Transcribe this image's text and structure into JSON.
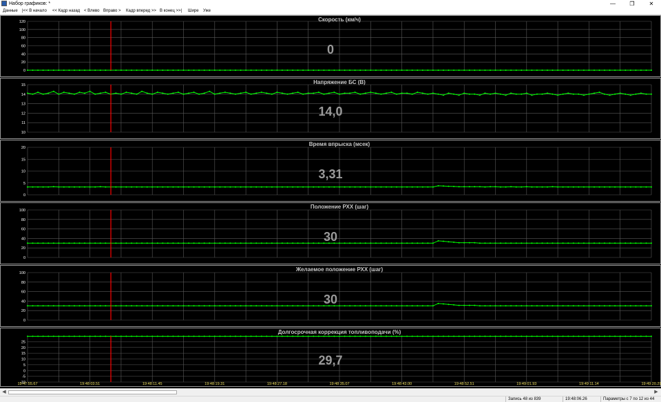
{
  "window": {
    "title": "Набор графиков: *",
    "buttons": [
      "—",
      "❐",
      "✕"
    ]
  },
  "menu": [
    "Данные",
    "|<< В начало",
    "<< Кадр назад",
    "< Влево",
    "Вправо >",
    "Кадр вперед >>",
    "В конец >>|",
    "Шире",
    "Уже"
  ],
  "status": {
    "record": "Запись 48 из 839",
    "time": "19:48:06.26",
    "params": "Параметры с 7 по 12 из 44"
  },
  "colors": {
    "background": "#000000",
    "grid": "#5a5a5a",
    "series": "#00ff00",
    "cursor": "#ff0000",
    "title": "#c8c8c8",
    "value": "#9a9a9a",
    "xtick": "#f0e060"
  },
  "chart_data": [
    {
      "type": "line",
      "title": "Скорость  (км/ч)",
      "ylim": [
        0,
        120
      ],
      "yticks": [
        "120",
        "100",
        "80",
        "60",
        "40",
        "20",
        "0"
      ],
      "current_value": "0",
      "values": [
        0,
        0,
        0,
        0,
        0,
        0,
        0,
        0,
        0,
        0,
        0,
        0,
        0,
        0,
        0,
        0,
        0,
        0,
        0,
        0,
        0,
        0,
        0,
        0,
        0,
        0,
        0,
        0,
        0,
        0,
        0,
        0,
        0,
        0,
        0,
        0,
        0,
        0,
        0,
        0,
        0,
        0,
        0,
        0,
        0,
        0,
        0,
        0,
        0,
        0,
        0,
        0,
        0,
        0,
        0,
        0,
        0,
        0,
        0,
        0,
        0,
        0,
        0,
        0,
        0,
        0,
        0,
        0,
        0,
        0,
        0,
        0,
        0,
        0,
        0,
        0,
        0,
        0,
        0,
        0,
        0,
        0,
        0,
        0,
        0,
        0,
        0,
        0,
        0,
        0,
        0,
        0,
        0,
        0,
        0,
        0,
        0,
        0,
        0,
        0,
        0,
        0,
        0,
        0,
        0,
        0,
        0,
        0,
        0,
        0,
        0,
        0,
        0,
        0,
        0,
        0,
        0,
        0,
        0,
        0,
        0
      ]
    },
    {
      "type": "line",
      "title": "Напряжение БС  (В)",
      "ylim": [
        10,
        15
      ],
      "yticks": [
        "15",
        "14",
        "13",
        "12",
        "11",
        "10"
      ],
      "current_value": "14,0",
      "values": [
        14.1,
        14.0,
        14.2,
        14.0,
        14.1,
        14.3,
        14.0,
        14.2,
        14.1,
        14.0,
        14.2,
        14.1,
        14.3,
        14.0,
        14.1,
        14.2,
        14.0,
        14.1,
        14.0,
        14.2,
        14.1,
        14.0,
        14.3,
        14.1,
        14.0,
        14.2,
        14.1,
        14.0,
        14.1,
        14.2,
        14.0,
        14.1,
        14.2,
        14.0,
        14.1,
        14.3,
        14.0,
        14.1,
        14.2,
        14.1,
        14.0,
        14.1,
        14.2,
        14.0,
        14.1,
        14.2,
        14.1,
        14.0,
        14.2,
        14.1,
        14.0,
        14.1,
        14.2,
        14.0,
        14.1,
        14.1,
        14.2,
        14.0,
        14.1,
        14.2,
        14.0,
        14.1,
        14.1,
        14.2,
        14.0,
        14.1,
        14.2,
        14.1,
        14.0,
        14.1,
        14.2,
        14.0,
        14.1,
        14.1,
        14.0,
        14.2,
        14.1,
        14.0,
        14.1,
        14.0,
        13.9,
        14.1,
        14.0,
        13.9,
        14.1,
        14.0,
        14.0,
        13.9,
        14.1,
        14.0,
        14.1,
        14.0,
        13.9,
        14.1,
        14.0,
        14.0,
        14.1,
        13.9,
        14.0,
        14.0,
        14.1,
        14.0,
        13.9,
        14.0,
        14.1,
        14.0,
        14.0,
        13.9,
        14.0,
        14.1,
        14.2,
        14.0,
        13.9,
        14.0,
        14.1,
        14.0,
        13.9,
        14.0,
        14.1,
        14.0,
        14.0
      ]
    },
    {
      "type": "line",
      "title": "Время впрыска  (мсек)",
      "ylim": [
        0,
        20
      ],
      "yticks": [
        "20",
        "15",
        "10",
        "5",
        "0"
      ],
      "current_value": "3,31",
      "values": [
        3.3,
        3.3,
        3.3,
        3.3,
        3.3,
        3.4,
        3.3,
        3.3,
        3.3,
        3.3,
        3.3,
        3.3,
        3.3,
        3.3,
        3.4,
        3.3,
        3.3,
        3.3,
        3.3,
        3.3,
        3.3,
        3.3,
        3.3,
        3.3,
        3.3,
        3.3,
        3.3,
        3.3,
        3.3,
        3.3,
        3.3,
        3.3,
        3.3,
        3.3,
        3.3,
        3.3,
        3.3,
        3.3,
        3.3,
        3.3,
        3.3,
        3.3,
        3.3,
        3.3,
        3.3,
        3.3,
        3.3,
        3.3,
        3.3,
        3.3,
        3.3,
        3.3,
        3.3,
        3.3,
        3.3,
        3.3,
        3.3,
        3.3,
        3.3,
        3.3,
        3.3,
        3.3,
        3.3,
        3.3,
        3.3,
        3.3,
        3.3,
        3.3,
        3.3,
        3.3,
        3.3,
        3.3,
        3.3,
        3.3,
        3.3,
        3.3,
        3.3,
        3.3,
        3.3,
        3.8,
        3.7,
        3.6,
        3.5,
        3.4,
        3.4,
        3.4,
        3.4,
        3.4,
        3.3,
        3.4,
        3.4,
        3.3,
        3.3,
        3.4,
        3.3,
        3.3,
        3.4,
        3.3,
        3.3,
        3.3,
        3.3,
        3.4,
        3.3,
        3.3,
        3.3,
        3.3,
        3.3,
        3.3,
        3.3,
        3.3,
        3.3,
        3.3,
        3.3,
        3.3,
        3.3,
        3.3,
        3.3,
        3.3,
        3.3,
        3.3,
        3.3
      ]
    },
    {
      "type": "line",
      "title": "Положение РХХ  (шаг)",
      "ylim": [
        0,
        100
      ],
      "yticks": [
        "100",
        "80",
        "60",
        "40",
        "20",
        "0"
      ],
      "current_value": "30",
      "values": [
        30,
        30,
        30,
        30,
        30,
        30,
        30,
        30,
        30,
        30,
        30,
        30,
        30,
        30,
        30,
        30,
        30,
        30,
        30,
        30,
        30,
        30,
        30,
        30,
        30,
        30,
        30,
        30,
        30,
        30,
        30,
        30,
        30,
        30,
        30,
        30,
        30,
        30,
        30,
        30,
        30,
        30,
        30,
        30,
        30,
        30,
        30,
        30,
        30,
        30,
        30,
        30,
        30,
        30,
        30,
        30,
        30,
        30,
        30,
        30,
        30,
        30,
        30,
        30,
        30,
        30,
        30,
        30,
        30,
        30,
        30,
        30,
        30,
        30,
        30,
        30,
        30,
        30,
        30,
        35,
        34,
        33,
        32,
        31,
        31,
        31,
        31,
        30,
        30,
        30,
        30,
        30,
        30,
        30,
        30,
        30,
        30,
        30,
        30,
        30,
        30,
        30,
        30,
        30,
        30,
        30,
        30,
        30,
        30,
        30,
        30,
        30,
        30,
        30,
        30,
        30,
        30,
        30,
        30,
        30,
        30
      ]
    },
    {
      "type": "line",
      "title": "Желаемое положение РХХ  (шаг)",
      "ylim": [
        0,
        100
      ],
      "yticks": [
        "100",
        "80",
        "60",
        "40",
        "20",
        "0"
      ],
      "current_value": "30",
      "values": [
        30,
        30,
        30,
        30,
        30,
        30,
        30,
        30,
        30,
        30,
        30,
        30,
        30,
        30,
        30,
        30,
        30,
        30,
        30,
        30,
        30,
        30,
        30,
        30,
        30,
        30,
        30,
        30,
        30,
        30,
        30,
        30,
        30,
        30,
        30,
        30,
        30,
        30,
        30,
        30,
        30,
        30,
        30,
        30,
        30,
        30,
        30,
        30,
        30,
        30,
        30,
        30,
        30,
        30,
        30,
        30,
        30,
        30,
        30,
        30,
        30,
        30,
        30,
        30,
        30,
        30,
        30,
        30,
        30,
        30,
        30,
        30,
        30,
        30,
        30,
        30,
        30,
        30,
        30,
        35,
        34,
        33,
        32,
        31,
        31,
        31,
        31,
        30,
        30,
        30,
        30,
        30,
        30,
        30,
        30,
        30,
        30,
        30,
        30,
        30,
        30,
        30,
        30,
        30,
        30,
        30,
        30,
        30,
        30,
        30,
        30,
        30,
        30,
        30,
        30,
        30,
        30,
        30,
        30,
        30,
        30
      ]
    },
    {
      "type": "line",
      "title": "Долгосрочная коррекция топливоподачи  (%)",
      "ylim": [
        -10,
        30
      ],
      "yticks": [
        "25",
        "20",
        "15",
        "10",
        "5",
        "0",
        "-5",
        "-10"
      ],
      "current_value": "29,7",
      "values": [
        29.7,
        29.7,
        29.7,
        29.7,
        29.7,
        29.7,
        29.7,
        29.7,
        29.7,
        29.7,
        29.7,
        29.7,
        29.7,
        29.7,
        29.7,
        29.7,
        29.7,
        29.7,
        29.7,
        29.7,
        29.7,
        29.7,
        29.7,
        29.7,
        29.7,
        29.7,
        29.7,
        29.7,
        29.7,
        29.7,
        29.7,
        29.7,
        29.7,
        29.7,
        29.7,
        29.7,
        29.7,
        29.7,
        29.7,
        29.7,
        29.7,
        29.7,
        29.7,
        29.7,
        29.7,
        29.7,
        29.7,
        29.7,
        29.7,
        29.7,
        29.7,
        29.7,
        29.7,
        29.7,
        29.7,
        29.7,
        29.7,
        29.7,
        29.7,
        29.7,
        29.7,
        29.7,
        29.7,
        29.7,
        29.7,
        29.7,
        29.7,
        29.7,
        29.7,
        29.7,
        29.7,
        29.7,
        29.7,
        29.7,
        29.7,
        29.7,
        29.7,
        29.7,
        29.7,
        29.7,
        29.7,
        29.7,
        29.7,
        29.7,
        29.7,
        29.7,
        29.7,
        29.7,
        29.7,
        29.7,
        29.7,
        29.7,
        29.7,
        29.7,
        29.7,
        29.7,
        29.7,
        29.7,
        29.7,
        29.7,
        29.7,
        29.7,
        29.7,
        29.7,
        29.7,
        29.7,
        29.7,
        29.7,
        29.7,
        29.7,
        29.7,
        29.7,
        29.7,
        29.7,
        29.7,
        29.7,
        29.7,
        29.7,
        29.7,
        29.7,
        29.7
      ]
    }
  ],
  "x_ticks": [
    "19:47:55.67",
    "19:48:03.51",
    "19:48:11.45",
    "19:48:19.31",
    "19:48:27.18",
    "19:48:35.07",
    "19:48:43.00",
    "19:48:52.51",
    "19:49:01.93",
    "19:49:11.14",
    "19:49:20.29"
  ],
  "cursor_time": "19:48:06.26"
}
